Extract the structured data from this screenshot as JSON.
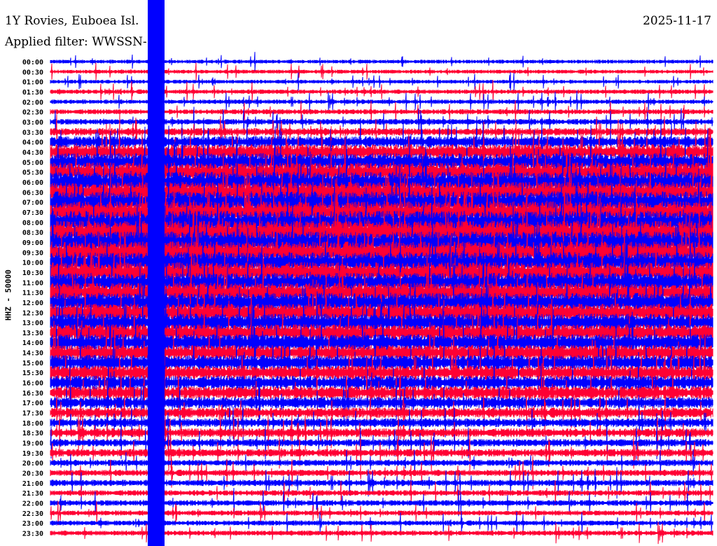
{
  "header": {
    "station": "1Y Rovies, Euboea Isl.",
    "filter": "Applied filter: WWSSN-SP",
    "date": "2025-11-17"
  },
  "chart_data": {
    "type": "line",
    "subtype": "helicorder",
    "title": "1Y Rovies, Euboea Isl.",
    "ylabel": "HHZ - 50000",
    "xlabel": "",
    "row_labels": [
      "00:00",
      "00:30",
      "01:00",
      "01:30",
      "02:00",
      "02:30",
      "03:00",
      "03:30",
      "04:00",
      "04:30",
      "05:00",
      "05:30",
      "06:00",
      "06:30",
      "07:00",
      "07:30",
      "08:00",
      "08:30",
      "09:00",
      "09:30",
      "10:00",
      "10:30",
      "11:00",
      "11:30",
      "12:00",
      "12:30",
      "13:00",
      "13:30",
      "14:00",
      "14:30",
      "15:00",
      "15:30",
      "16:00",
      "16:30",
      "17:00",
      "17:30",
      "18:00",
      "18:30",
      "19:00",
      "19:30",
      "20:00",
      "20:30",
      "21:00",
      "21:30",
      "22:00",
      "22:30",
      "23:00",
      "23:30"
    ],
    "row_colors": [
      "#0000ff",
      "#ff0033"
    ],
    "relative_noise_amplitude": [
      0.3,
      0.3,
      0.3,
      0.35,
      0.35,
      0.4,
      0.45,
      0.6,
      0.9,
      1.2,
      1.4,
      1.5,
      1.6,
      1.6,
      1.7,
      1.7,
      1.8,
      1.8,
      1.7,
      1.7,
      1.6,
      1.6,
      1.5,
      1.5,
      1.5,
      1.4,
      1.4,
      1.3,
      1.3,
      1.2,
      1.2,
      1.1,
      1.1,
      1.0,
      0.9,
      0.8,
      0.7,
      0.7,
      0.6,
      0.6,
      0.5,
      0.5,
      0.5,
      0.45,
      0.45,
      0.4,
      0.4,
      0.4
    ],
    "event": {
      "start_row_label": "00:00",
      "description_color": "#0000ff"
    }
  }
}
